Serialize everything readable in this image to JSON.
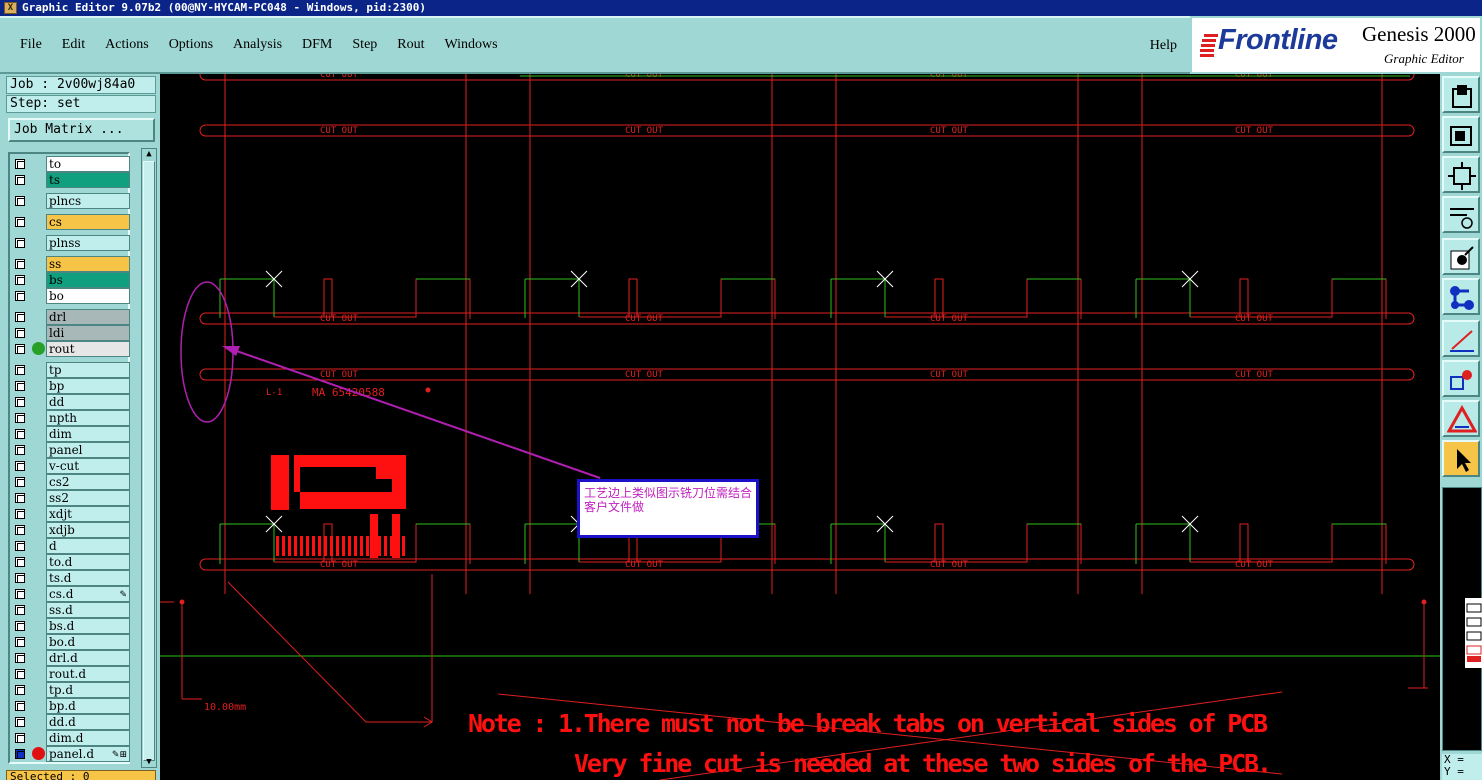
{
  "window": {
    "title": "Graphic Editor 9.07b2 (00@NY-HYCAM-PC048 - Windows, pid:2300)",
    "icon": "x-app-icon"
  },
  "menu": {
    "items": [
      "File",
      "Edit",
      "Actions",
      "Options",
      "Analysis",
      "DFM",
      "Step",
      "Rout",
      "Windows"
    ],
    "help": "Help"
  },
  "logo": {
    "brand": "Frontline",
    "product": "Genesis 2000",
    "subtitle": "Graphic Editor"
  },
  "job": {
    "job_label": "Job : 2v00wj84a0",
    "step_label": "Step: set",
    "matrix_button": "Job Matrix ..."
  },
  "layers": [
    {
      "name": "to",
      "color": "#ffffff",
      "dot": ""
    },
    {
      "name": "ts",
      "color": "#10a080",
      "dot": ""
    },
    {
      "name": "plncs",
      "color": "#bfeeed",
      "dot": ""
    },
    {
      "name": "cs",
      "color": "#f6c447",
      "dot": ""
    },
    {
      "name": "plnss",
      "color": "#bfeeed",
      "dot": ""
    },
    {
      "name": "ss",
      "color": "#f6c447",
      "dot": ""
    },
    {
      "name": "bs",
      "color": "#10a080",
      "dot": ""
    },
    {
      "name": "bo",
      "color": "#ffffff",
      "dot": ""
    },
    {
      "name": "drl",
      "color": "#a8b8b8",
      "dot": ""
    },
    {
      "name": "ldi",
      "color": "#a8b8b8",
      "dot": ""
    },
    {
      "name": "rout",
      "color": "#e6e6e6",
      "dot": "#28a028"
    },
    {
      "name": "tp",
      "color": "#bfeeed",
      "dot": ""
    },
    {
      "name": "bp",
      "color": "#bfeeed",
      "dot": ""
    },
    {
      "name": "dd",
      "color": "#bfeeed",
      "dot": ""
    },
    {
      "name": "npth",
      "color": "#bfeeed",
      "dot": ""
    },
    {
      "name": "dim",
      "color": "#bfeeed",
      "dot": ""
    },
    {
      "name": "panel",
      "color": "#bfeeed",
      "dot": ""
    },
    {
      "name": "v-cut",
      "color": "#bfeeed",
      "dot": ""
    },
    {
      "name": "cs2",
      "color": "#bfeeed",
      "dot": ""
    },
    {
      "name": "ss2",
      "color": "#bfeeed",
      "dot": ""
    },
    {
      "name": "xdjt",
      "color": "#bfeeed",
      "dot": ""
    },
    {
      "name": "xdjb",
      "color": "#bfeeed",
      "dot": ""
    },
    {
      "name": "d",
      "color": "#bfeeed",
      "dot": ""
    },
    {
      "name": "to.d",
      "color": "#bfeeed",
      "dot": ""
    },
    {
      "name": "ts.d",
      "color": "#bfeeed",
      "dot": ""
    },
    {
      "name": "cs.d",
      "color": "#bfeeed",
      "dot": "",
      "mark": "✎"
    },
    {
      "name": "ss.d",
      "color": "#bfeeed",
      "dot": ""
    },
    {
      "name": "bs.d",
      "color": "#bfeeed",
      "dot": ""
    },
    {
      "name": "bo.d",
      "color": "#bfeeed",
      "dot": ""
    },
    {
      "name": "drl.d",
      "color": "#bfeeed",
      "dot": ""
    },
    {
      "name": "rout.d",
      "color": "#bfeeed",
      "dot": ""
    },
    {
      "name": "tp.d",
      "color": "#bfeeed",
      "dot": ""
    },
    {
      "name": "bp.d",
      "color": "#bfeeed",
      "dot": ""
    },
    {
      "name": "dd.d",
      "color": "#bfeeed",
      "dot": ""
    },
    {
      "name": "dim.d",
      "color": "#bfeeed",
      "dot": ""
    },
    {
      "name": "panel.d",
      "color": "#bfeeed",
      "dot": "#e01010",
      "mark": "✎⊞",
      "checked": true
    }
  ],
  "status": {
    "selected": "Selected : 0"
  },
  "canvas": {
    "cutout_label": "CUT OUT",
    "marker_left": "L-1",
    "marker_code": "MA 65420588",
    "dimension": "10.00mm",
    "note_line1": "Note : 1.There must not be break tabs on vertical sides of PCB",
    "note_line2": "Very fine cut is needed at these two sides of the PCB.",
    "annotation": "工艺边上类似图示铣刀位需结合客户文件做",
    "colors": {
      "outline": "#e02020",
      "board_edge": "#30c020",
      "annotation_arrow": "#b020b0",
      "note_text": "#ff1010"
    }
  },
  "coords": {
    "x": "X =",
    "y": "Y ="
  },
  "tools": [
    "layer-up-icon",
    "layer-down-icon",
    "zoom-fit-icon",
    "measure-icon",
    "snap-icon",
    "nodes-icon",
    "line-draw-icon",
    "shapes-icon",
    "warning-icon",
    "pointer-icon"
  ]
}
